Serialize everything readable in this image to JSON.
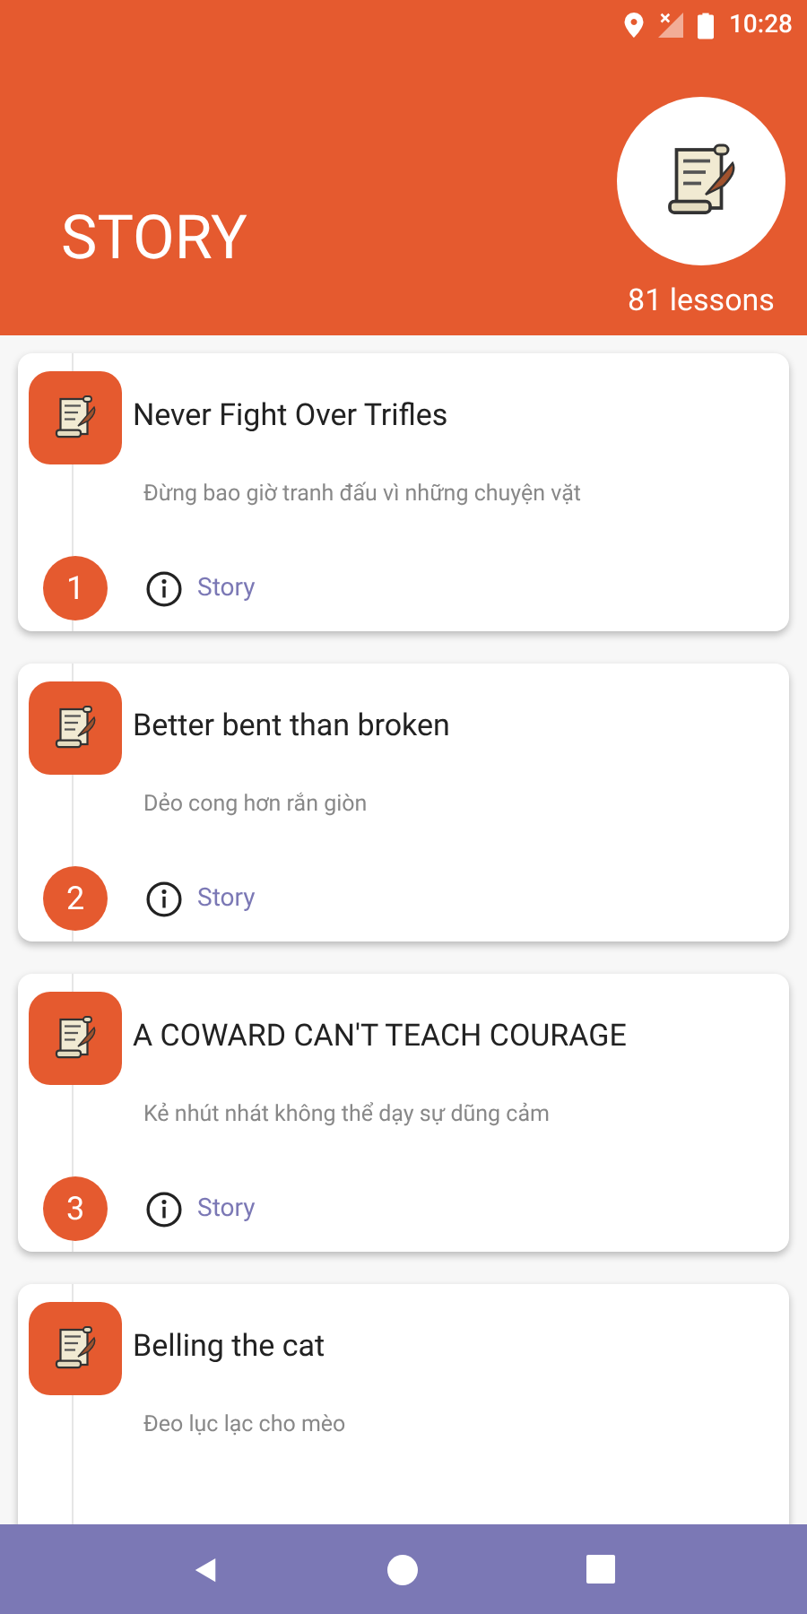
{
  "status_bar": {
    "time": "10:28"
  },
  "header": {
    "title": "STORY",
    "lesson_count": "81 lessons"
  },
  "lessons": [
    {
      "number": "1",
      "title": "Never Fight Over Trifles",
      "subtitle": "Đừng bao giờ tranh đấu vì những chuyện vặt",
      "category": "Story"
    },
    {
      "number": "2",
      "title": "Better bent than broken",
      "subtitle": "Dẻo cong hơn rắn giòn",
      "category": "Story"
    },
    {
      "number": "3",
      "title": "A COWARD CAN'T TEACH COURAGE",
      "subtitle": "Kẻ nhút nhát không thể dạy sự dũng cảm",
      "category": "Story"
    },
    {
      "title": "Belling the cat",
      "subtitle": "Đeo lục lạc cho mèo"
    }
  ]
}
